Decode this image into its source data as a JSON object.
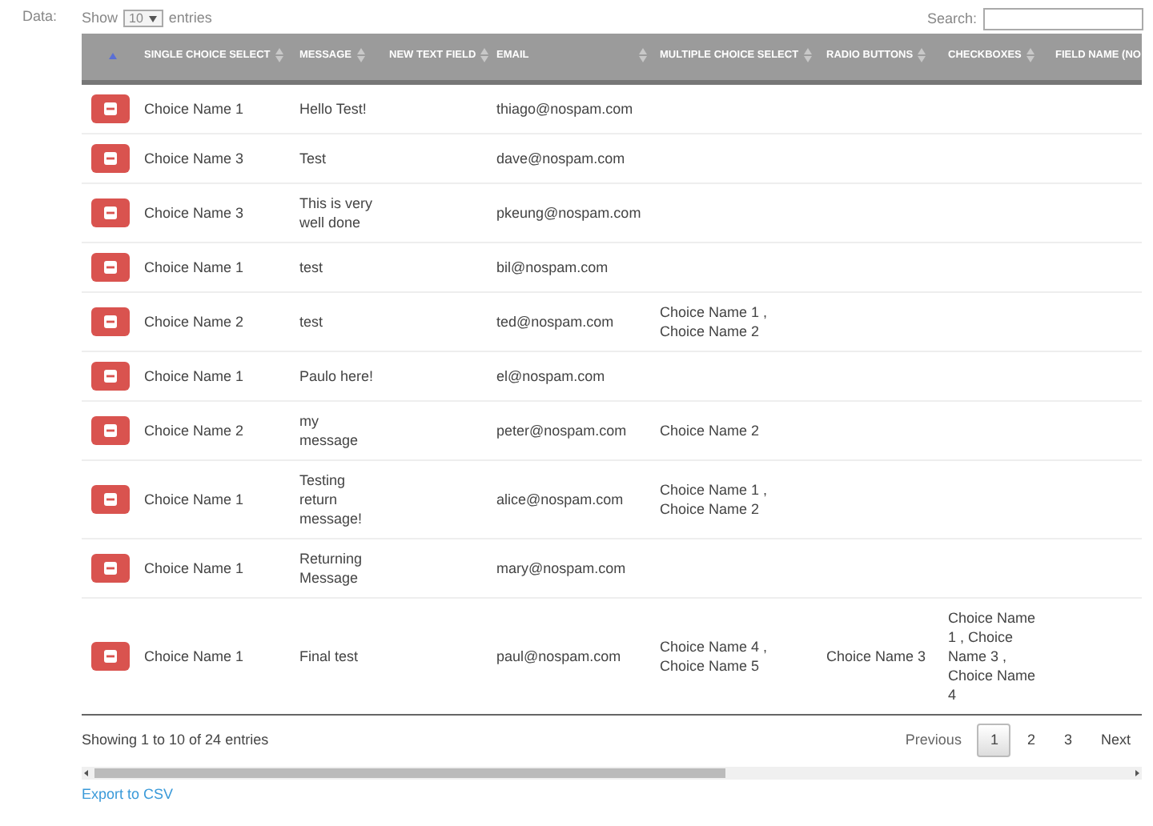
{
  "field_label": "Data:",
  "length_menu": {
    "before": "Show",
    "value": "10",
    "after": "entries"
  },
  "search": {
    "label": "Search:"
  },
  "columns": [
    {
      "sorted": true
    },
    {
      "label": "SINGLE CHOICE SELECT",
      "sorted": false
    },
    {
      "label": "MESSAGE",
      "sorted": false
    },
    {
      "label": "NEW TEXT FIELD",
      "sorted": false
    },
    {
      "label": "EMAIL",
      "sorted": false
    },
    {
      "label": "MULTIPLE CHOICE SELECT",
      "sorted": false
    },
    {
      "label": "RADIO BUTTONS",
      "sorted": false
    },
    {
      "label": "CHECKBOXES",
      "sorted": false
    },
    {
      "label": "FIELD NAME (NO"
    }
  ],
  "rows": [
    {
      "single": "Choice Name 1",
      "message": "Hello Test!",
      "email": "thiago@nospam.com"
    },
    {
      "single": "Choice Name 3",
      "message": "Test",
      "email": "dave@nospam.com"
    },
    {
      "single": "Choice Name 3",
      "message": "This is very well done",
      "email": "pkeung@nospam.com"
    },
    {
      "single": "Choice Name 1",
      "message": "test",
      "email": "bil@nospam.com"
    },
    {
      "single": "Choice Name 2",
      "message": "test",
      "email": "ted@nospam.com",
      "multiple": "Choice Name 1 , Choice Name 2"
    },
    {
      "single": "Choice Name 1",
      "message": "Paulo here!",
      "email": "el@nospam.com"
    },
    {
      "single": "Choice Name 2",
      "message": "my message",
      "email": "peter@nospam.com",
      "multiple": "Choice Name 2"
    },
    {
      "single": "Choice Name 1",
      "message": "Testing return message!",
      "email": "alice@nospam.com",
      "multiple": "Choice Name 1 , Choice Name 2"
    },
    {
      "single": "Choice Name 1",
      "message": "Returning Message",
      "email": "mary@nospam.com"
    },
    {
      "single": "Choice Name 1",
      "message": "Final test",
      "email": "paul@nospam.com",
      "multiple": "Choice Name 4 , Choice Name 5",
      "radio": "Choice Name 3",
      "checkboxes": "Choice Name 1 , Choice Name 3 , Choice Name 4"
    }
  ],
  "info": "Showing 1 to 10 of 24 entries",
  "pagination": {
    "previous": "Previous",
    "pages": [
      {
        "label": "1",
        "selected": true
      },
      {
        "label": "2",
        "selected": false
      },
      {
        "label": "3",
        "selected": false
      }
    ],
    "next": "Next"
  },
  "export_link": "Export to CSV"
}
